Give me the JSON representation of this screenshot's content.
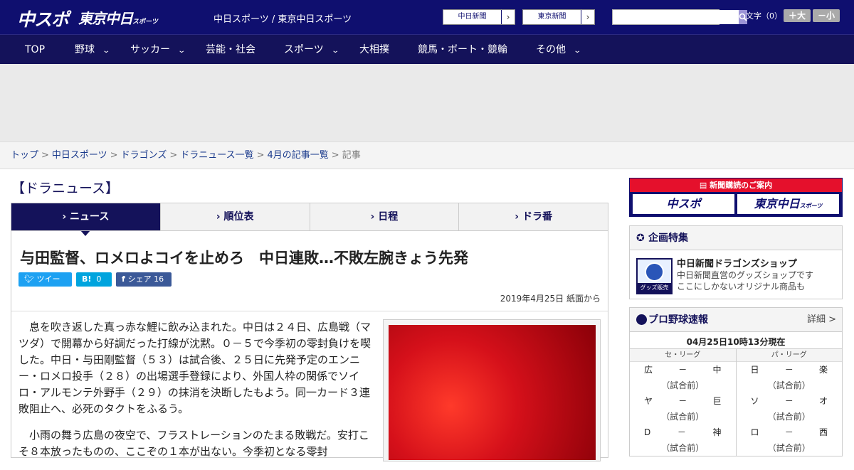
{
  "header": {
    "logo_chuspo": "中スポ",
    "logo_tokyo": "東京中日",
    "logo_tokyo_small": "スポーツ",
    "site_links": "中日スポーツ / 東京中日スポーツ",
    "link_buttons": [
      "中日新聞",
      "東京新聞"
    ],
    "search_placeholder": "",
    "font_size_label": "文字（0）",
    "font_larger": "＋大",
    "font_smaller": "－小"
  },
  "nav": {
    "items": [
      {
        "label": "TOP"
      },
      {
        "label": "野球"
      },
      {
        "label": "サッカー"
      },
      {
        "label": "芸能・社会"
      },
      {
        "label": "スポーツ"
      },
      {
        "label": "大相撲"
      },
      {
        "label": "競馬・ボート・競輪"
      },
      {
        "label": "その他"
      }
    ]
  },
  "breadcrumb": {
    "items": [
      "トップ",
      "中日スポーツ",
      "ドラゴンズ",
      "ドラニュース一覧",
      "4月の記事一覧"
    ],
    "current": "記事",
    "separator": ">"
  },
  "section": {
    "title": "【ドラニュース】",
    "tabs": [
      "ニュース",
      "順位表",
      "日程",
      "ドラ番"
    ]
  },
  "article": {
    "headline": "与田監督、ロメロよコイを止めろ　中日連敗…不敗左腕きょう先発",
    "share": {
      "tweet": "ツイート",
      "hatena": "B!",
      "hatena_count": "0",
      "facebook": "シェア",
      "facebook_count": "16"
    },
    "dateline": "2019年4月25日 紙面から",
    "paragraphs": [
      "息を吹き返した真っ赤な鯉に飲み込まれた。中日は２４日、広島戦（マツダ）で開幕から好調だった打線が沈黙。０－５で今季初の零封負けを喫した。中日・与田剛監督（５３）は試合後、２５日に先発予定のエンニー・ロメロ投手（２８）の出場選手登録により、外国人枠の関係でソイロ・アルモンテ外野手（２９）の抹消を決断したもよう。同一カード３連敗阻止へ、必死のタクトをふるう。",
      "小雨の舞う広島の夜空で、フラストレーションのたまる敗戦だ。安打こそ８本放ったものの、ここぞの１本が出ない。今季初となる零封"
    ]
  },
  "sidebar": {
    "subscribe": {
      "head": "新聞購読のご案内",
      "logos": [
        "中スポ",
        "東京中日"
      ],
      "tokyo_small": "スポーツ"
    },
    "feature": {
      "head": "企画特集",
      "badge": "グッズ販売中",
      "title": "中日新聞ドラゴンズショップ",
      "desc_line1": "中日新聞直営のグッズショップです",
      "desc_line2": "ここにしかないオリジナル商品も"
    },
    "scores": {
      "head": "プロ野球速報",
      "detail": "詳細 >",
      "time": "04月25日10時13分現在",
      "central_label": "セ・リーグ",
      "pacific_label": "パ・リーグ",
      "central_games": [
        {
          "home": "広",
          "away": "中",
          "score": "－",
          "status": "（試合前）"
        },
        {
          "home": "ヤ",
          "away": "巨",
          "score": "－",
          "status": "（試合前）"
        },
        {
          "home": "D",
          "away": "神",
          "score": "－",
          "status": "（試合前）"
        }
      ],
      "pacific_games": [
        {
          "home": "日",
          "away": "楽",
          "score": "－",
          "status": "（試合前）"
        },
        {
          "home": "ソ",
          "away": "オ",
          "score": "－",
          "status": "（試合前）"
        },
        {
          "home": "ロ",
          "away": "西",
          "score": "－",
          "status": "（試合前）"
        }
      ]
    }
  },
  "colors": {
    "brand_navy": "#0f0f6f",
    "nav_navy": "#14125a",
    "subscribe_red": "#e5102c",
    "twitter": "#1da1f2",
    "hatena": "#00a4de",
    "facebook": "#3b5998"
  }
}
